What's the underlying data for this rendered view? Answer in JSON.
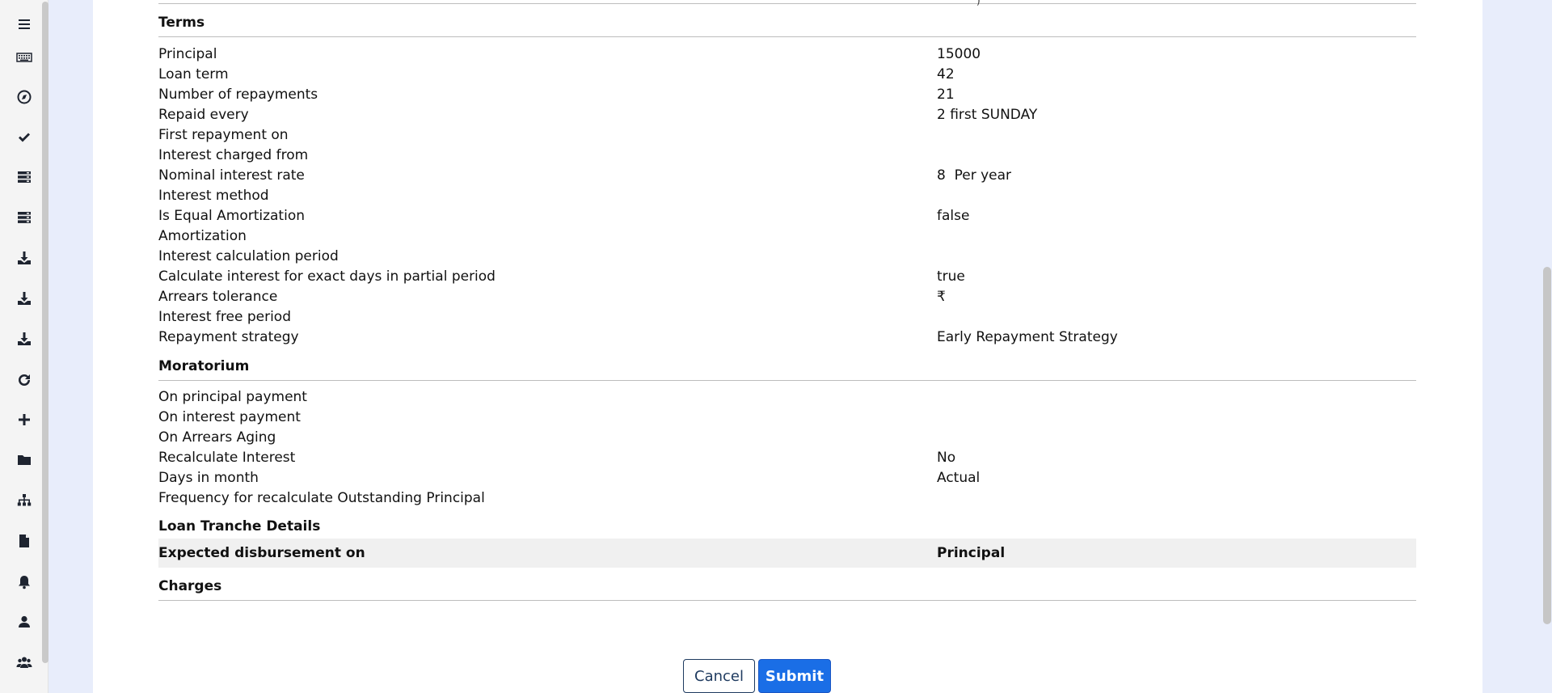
{
  "sidebar": {
    "icons": [
      "menu-icon",
      "keyboard-icon",
      "compass-icon",
      "check-icon",
      "server-icon",
      "server-icon",
      "download-icon",
      "download-icon",
      "download-icon",
      "refresh-icon",
      "plus-icon",
      "folder-icon",
      "sitemap-icon",
      "file-icon",
      "bell-icon",
      "user-icon",
      "users-icon"
    ]
  },
  "top_fragment": ")",
  "terms": {
    "title": "Terms",
    "rows": [
      {
        "label": "Principal",
        "value": "15000"
      },
      {
        "label": "Loan term",
        "value": "42"
      },
      {
        "label": "Number of repayments",
        "value": "21"
      },
      {
        "label": "Repaid every",
        "value": "2 first SUNDAY"
      },
      {
        "label": "First repayment on",
        "value": ""
      },
      {
        "label": "Interest charged from",
        "value": ""
      },
      {
        "label": "Nominal interest rate",
        "value": "8  Per year"
      },
      {
        "label": "Interest method",
        "value": ""
      },
      {
        "label": "Is Equal Amortization",
        "value": "false"
      },
      {
        "label": "Amortization",
        "value": ""
      },
      {
        "label": "Interest calculation period",
        "value": ""
      },
      {
        "label": "Calculate interest for exact days in partial period",
        "value": "true"
      },
      {
        "label": "Arrears tolerance",
        "value": "₹"
      },
      {
        "label": "Interest free period",
        "value": ""
      },
      {
        "label": "Repayment strategy",
        "value": "Early Repayment Strategy"
      }
    ]
  },
  "moratorium": {
    "title": "Moratorium",
    "rows": [
      {
        "label": "On principal payment",
        "value": ""
      },
      {
        "label": "On interest payment",
        "value": ""
      },
      {
        "label": "On Arrears Aging",
        "value": ""
      },
      {
        "label": "Recalculate Interest",
        "value": "No"
      },
      {
        "label": "Days in month",
        "value": "Actual"
      },
      {
        "label": "Frequency for recalculate Outstanding Principal",
        "value": ""
      }
    ]
  },
  "tranche": {
    "title": "Loan Tranche Details",
    "col_disbursement": "Expected disbursement on",
    "col_principal": "Principal"
  },
  "charges": {
    "title": "Charges"
  },
  "actions": {
    "cancel": "Cancel",
    "submit": "Submit"
  }
}
